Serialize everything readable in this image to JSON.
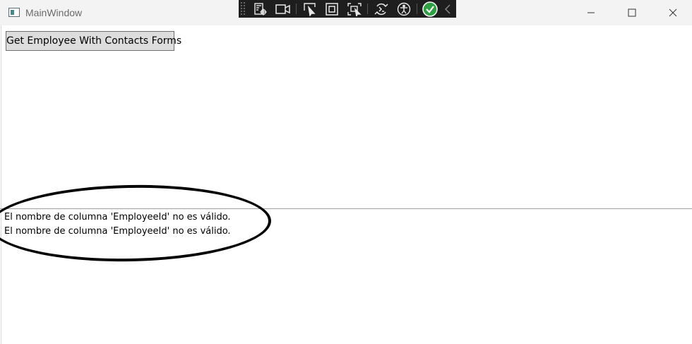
{
  "window": {
    "title": "MainWindow",
    "minimize_icon": "minimize-icon",
    "maximize_icon": "maximize-icon",
    "close_icon": "close-icon"
  },
  "debug_toolbar": {
    "items": [
      "live-visual-tree-icon",
      "record-icon",
      "select-element-icon",
      "display-layout-adorners-icon",
      "track-focus-icon",
      "hot-reload-icon",
      "accessibility-icon",
      "binding-check-icon",
      "collapse-icon"
    ],
    "check_color": "#2ea043"
  },
  "main": {
    "button_label": "Get Employee With Contacts Forms"
  },
  "messages": [
    "El nombre de columna 'EmployeeId' no es válido.",
    "El nombre de columna 'EmployeeId' no es válido."
  ]
}
